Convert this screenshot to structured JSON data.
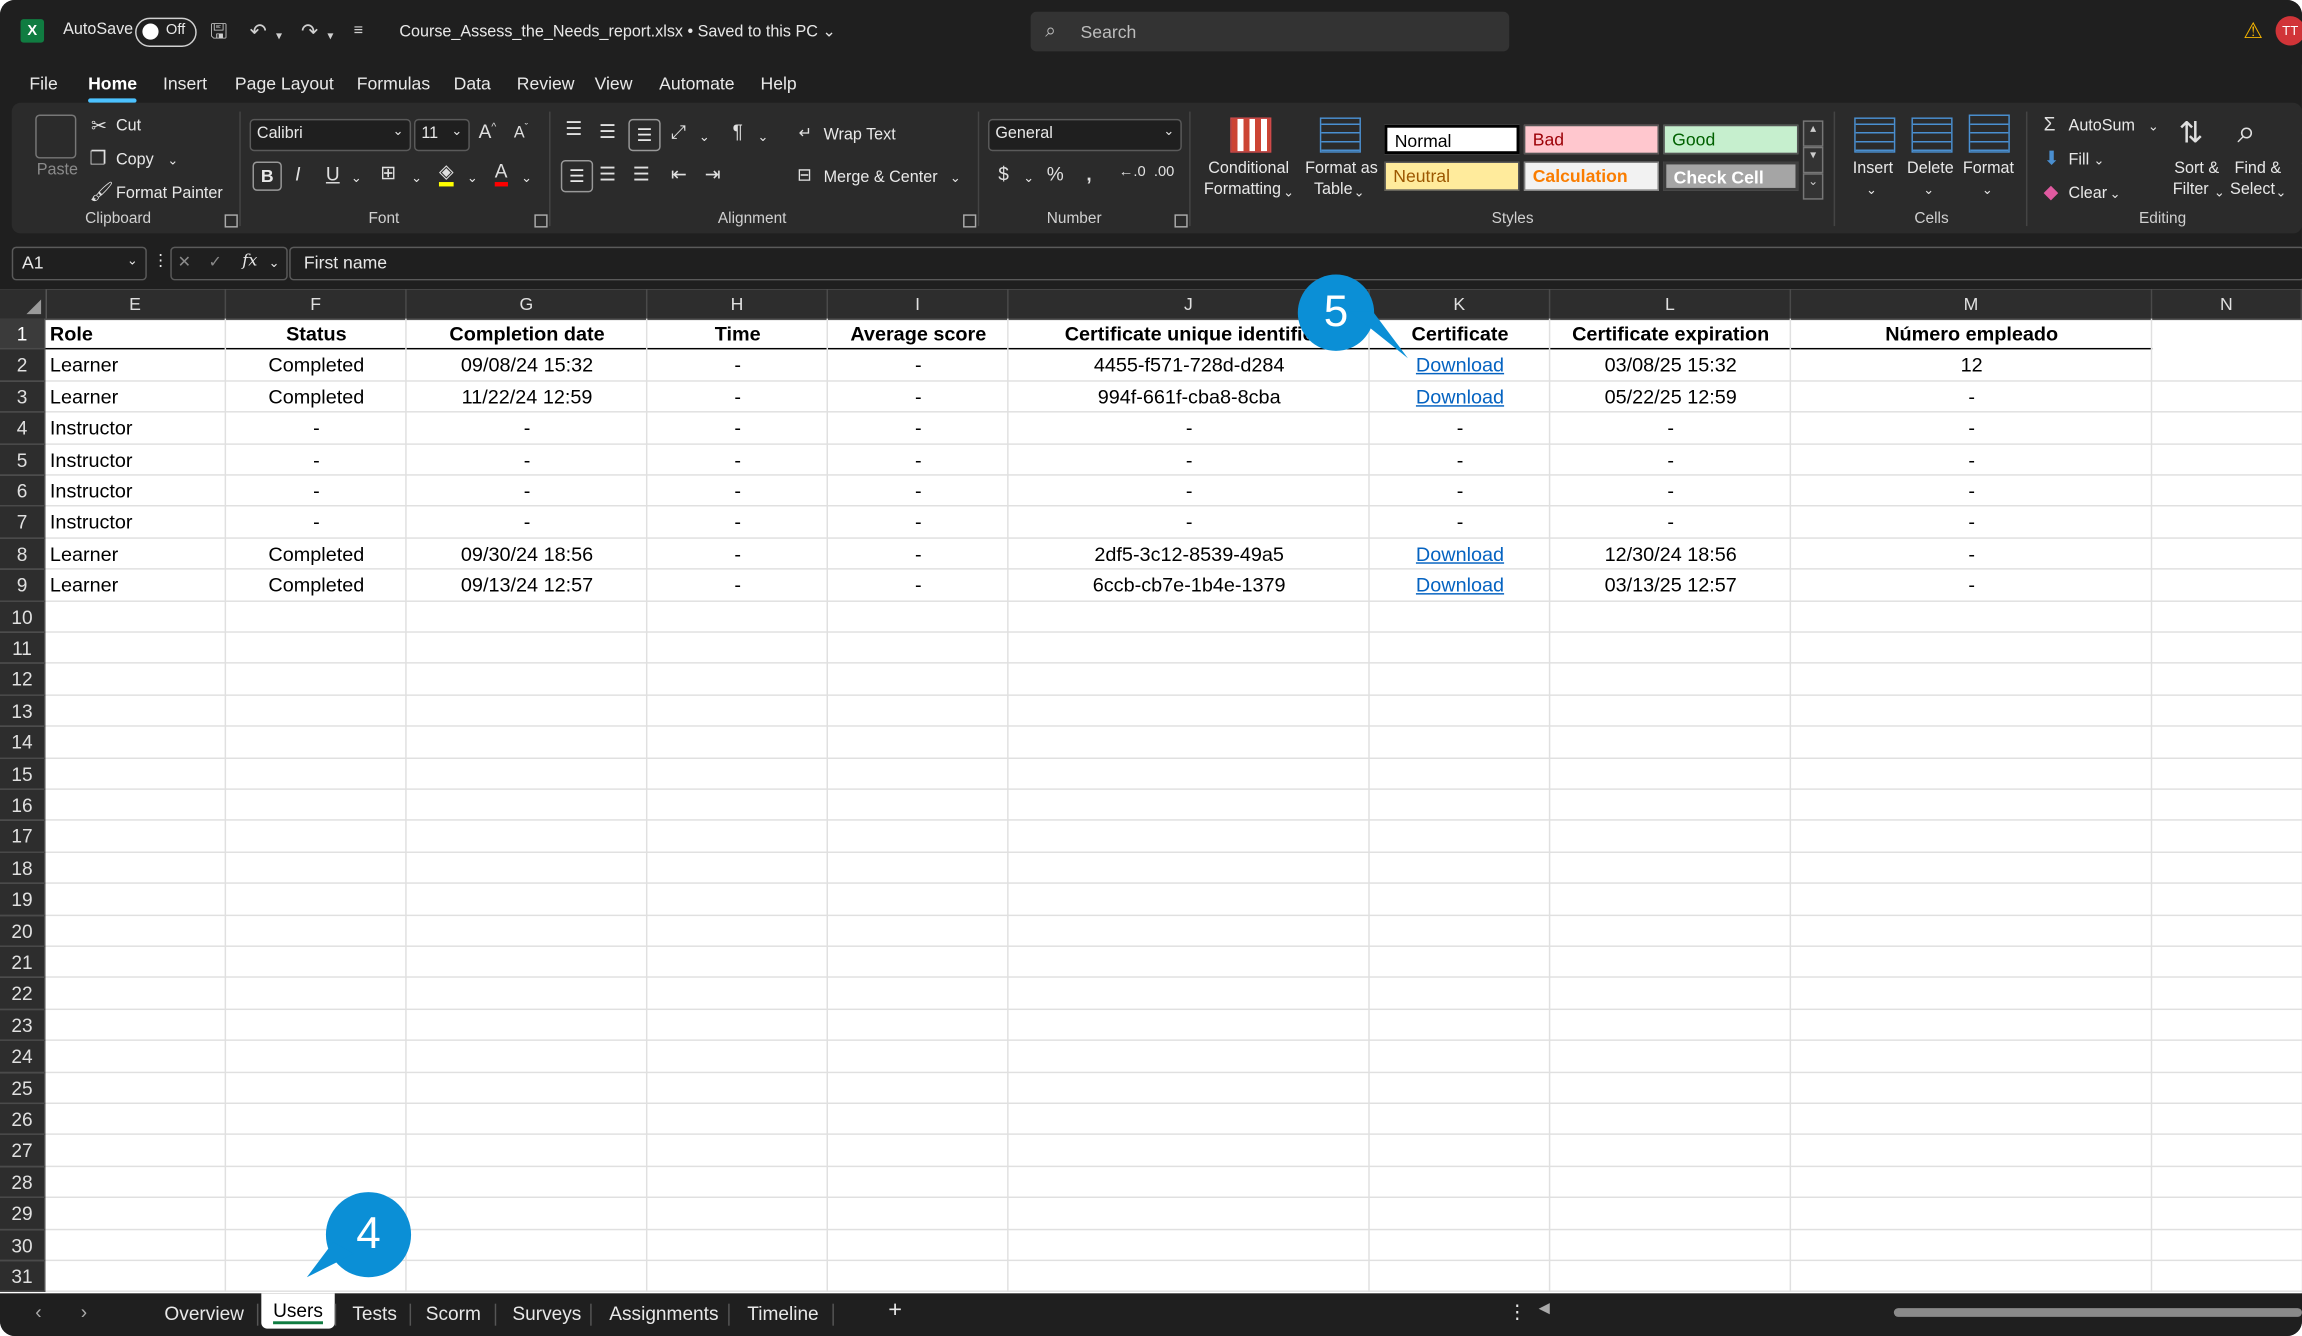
{
  "titlebar": {
    "autosave_label": "AutoSave",
    "autosave_state": "Off",
    "filename": "Course_Assess_the_Needs_report.xlsx  •  Saved to this PC",
    "search_placeholder": "Search",
    "avatar_initials": "TT"
  },
  "menu": {
    "tabs": [
      "File",
      "Home",
      "Insert",
      "Page Layout",
      "Formulas",
      "Data",
      "Review",
      "View",
      "Automate",
      "Help"
    ],
    "active": "Home"
  },
  "ribbon": {
    "clipboard": {
      "paste": "Paste",
      "cut": "Cut",
      "copy": "Copy",
      "format_painter": "Format Painter",
      "label": "Clipboard"
    },
    "font": {
      "name": "Calibri",
      "size": "11",
      "label": "Font"
    },
    "alignment": {
      "wrap_text": "Wrap Text",
      "merge_center": "Merge & Center",
      "label": "Alignment"
    },
    "number": {
      "format": "General",
      "label": "Number"
    },
    "styles": {
      "conditional_1": "Conditional",
      "conditional_2": "Formatting",
      "format_as_1": "Format as",
      "format_as_2": "Table",
      "normal": "Normal",
      "bad": "Bad",
      "good": "Good",
      "neutral": "Neutral",
      "calculation": "Calculation",
      "check_cell": "Check Cell",
      "label": "Styles"
    },
    "cells": {
      "insert": "Insert",
      "delete": "Delete",
      "format": "Format",
      "label": "Cells"
    },
    "editing": {
      "autosum": "AutoSum",
      "fill": "Fill",
      "clear": "Clear",
      "sort_1": "Sort &",
      "sort_2": "Filter",
      "find_1": "Find &",
      "find_2": "Select",
      "label": "Editing"
    }
  },
  "formula_bar": {
    "name_box": "A1",
    "content": "First name"
  },
  "columns": [
    "E",
    "F",
    "G",
    "H",
    "I",
    "J",
    "K",
    "L",
    "M",
    "N"
  ],
  "rows": [
    "1",
    "2",
    "3",
    "4",
    "5",
    "6",
    "7",
    "8",
    "9",
    "10",
    "11",
    "12",
    "13",
    "14",
    "15",
    "16",
    "17",
    "18",
    "19",
    "20",
    "21",
    "22",
    "23",
    "24",
    "25",
    "26",
    "27",
    "28",
    "29",
    "30",
    "31"
  ],
  "table": {
    "headers": [
      "Role",
      "Status",
      "Completion date",
      "Time",
      "Average score",
      "Certificate unique identifie",
      "Certificate",
      "Certificate expiration",
      "Número empleado"
    ],
    "data": [
      [
        "Learner",
        "Completed",
        "09/08/24 15:32",
        "-",
        "-",
        "4455-f571-728d-d284",
        "Download",
        "03/08/25 15:32",
        "12"
      ],
      [
        "Learner",
        "Completed",
        "11/22/24 12:59",
        "-",
        "-",
        "994f-661f-cba8-8cba",
        "Download",
        "05/22/25 12:59",
        "-"
      ],
      [
        "Instructor",
        "-",
        "-",
        "-",
        "-",
        "-",
        "-",
        "-",
        "-"
      ],
      [
        "Instructor",
        "-",
        "-",
        "-",
        "-",
        "-",
        "-",
        "-",
        "-"
      ],
      [
        "Instructor",
        "-",
        "-",
        "-",
        "-",
        "-",
        "-",
        "-",
        "-"
      ],
      [
        "Instructor",
        "-",
        "-",
        "-",
        "-",
        "-",
        "-",
        "-",
        "-"
      ],
      [
        "Learner",
        "Completed",
        "09/30/24 18:56",
        "-",
        "-",
        "2df5-3c12-8539-49a5",
        "Download",
        "12/30/24 18:56",
        "-"
      ],
      [
        "Learner",
        "Completed",
        "09/13/24 12:57",
        "-",
        "-",
        "6ccb-cb7e-1b4e-1379",
        "Download",
        "03/13/25 12:57",
        "-"
      ]
    ]
  },
  "callouts": {
    "users_tab": "4",
    "certificate_column": "5"
  },
  "sheets": {
    "tabs": [
      "Overview",
      "Users",
      "Tests",
      "Scorm",
      "Surveys",
      "Assignments",
      "Timeline"
    ],
    "active": "Users",
    "add": "+"
  },
  "colors": {
    "accent": "#4cc2ff",
    "excel_green": "#107c41",
    "link": "#0563c1",
    "callout": "#0b8fd6",
    "bad_bg": "#ffc7ce",
    "good_bg": "#c6efce",
    "neutral_bg": "#ffeb9c"
  }
}
